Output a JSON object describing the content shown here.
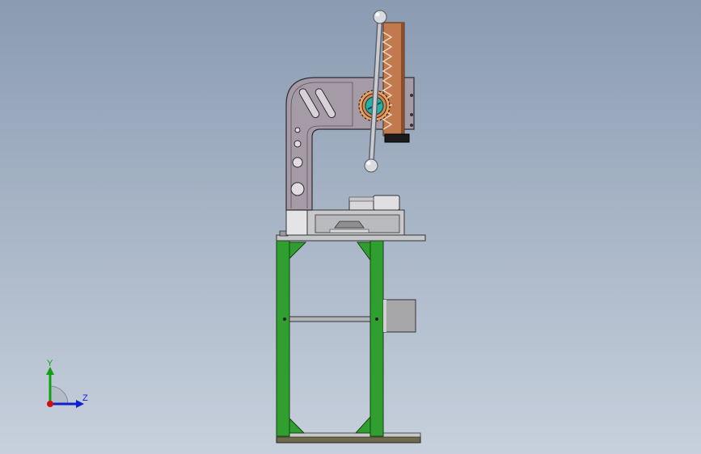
{
  "viewport": {
    "background_top": "#8a9bb2",
    "background_bottom": "#c7d0dc"
  },
  "colors": {
    "stand_green": "#2fa02f",
    "stand_green_dark": "#1d6e1d",
    "frame_gray": "#a59ba6",
    "frame_edge": "#3a3a3a",
    "rack_copper": "#c07a4e",
    "rack_light": "#e8c3a3",
    "gear_teal": "#28b0a8",
    "handle_gray": "#b8bcc2",
    "base_gray": "#c8c8c8",
    "axis_x": "#d01010",
    "axis_y": "#10a010",
    "axis_z": "#1020d0"
  },
  "triad": {
    "y_label": "Y",
    "z_label": "Z"
  },
  "icons": {
    "triad": "view-orientation-triad-icon",
    "model": "hand-press-assembly-model"
  }
}
